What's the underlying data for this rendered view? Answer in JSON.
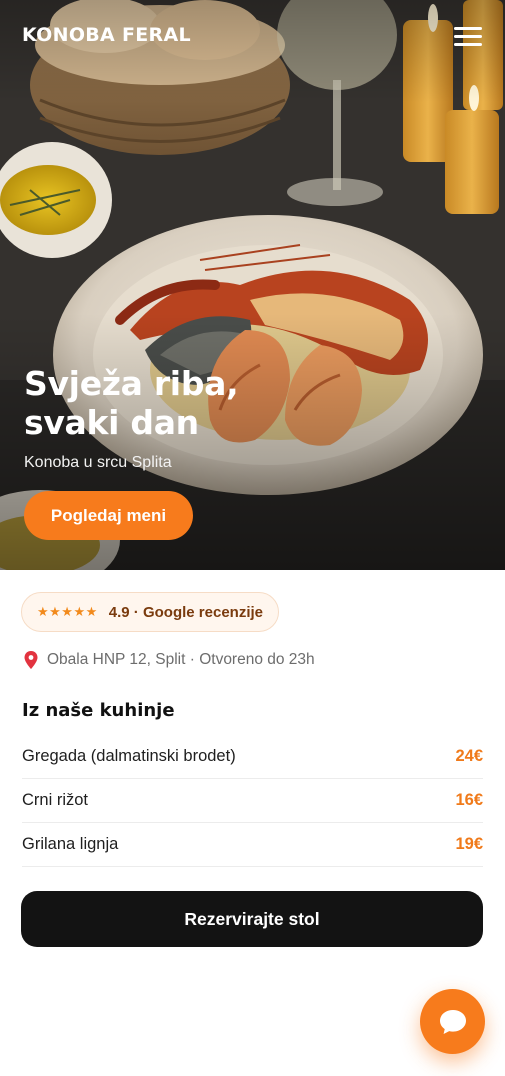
{
  "header": {
    "brand": "KONOBA FERAL",
    "menu_icon": "hamburger-menu-icon"
  },
  "hero": {
    "title_line1": "Svježa riba,",
    "title_line2": "svaki dan",
    "subtitle": "Konoba u srcu Splita",
    "cta_label": "Pogledaj meni"
  },
  "rating": {
    "stars": "★★★★★",
    "text": "4.9 · Google recenzije",
    "value": 4.9
  },
  "location": {
    "icon": "location-pin-icon",
    "text": "Obala HNP 12, Split · Otvoreno do 23h"
  },
  "menu_section": {
    "title": "Iz naše kuhinje",
    "items": [
      {
        "name": "Gregada (dalmatinski brodet)",
        "price": "24€"
      },
      {
        "name": "Crni rižot",
        "price": "16€"
      },
      {
        "name": "Grilana lignja",
        "price": "19€"
      }
    ]
  },
  "reserve": {
    "label": "Rezervirajte stol"
  },
  "chat": {
    "icon": "chat-bubble-icon"
  },
  "colors": {
    "accent": "#f77b1c",
    "price": "#f07a1a",
    "button_dark": "#131313",
    "rating_bg": "#fff6ee",
    "rating_text": "#7a3b0e"
  }
}
